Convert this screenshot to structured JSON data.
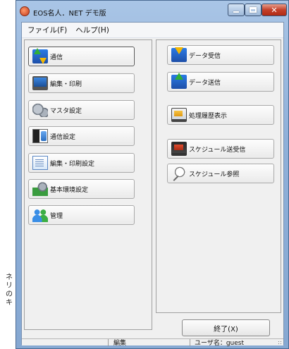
{
  "background_left_text": [
    "ネ",
    "リ",
    "の",
    "キ"
  ],
  "window": {
    "title": "EOS名人．NET デモ版",
    "accent_color": "#8fb0d9",
    "controls": {
      "minimize": "min",
      "maximize": "max",
      "close": "✕"
    }
  },
  "menubar": {
    "items": [
      {
        "label": "ファイル(F)"
      },
      {
        "label": "ヘルプ(H)"
      }
    ]
  },
  "left_pane": {
    "buttons": [
      {
        "label": "通信",
        "icon": "transfer-icon",
        "selected": true
      },
      {
        "label": "編集・印刷",
        "icon": "monitor-icon"
      },
      {
        "label": "マスタ設定",
        "icon": "gears-icon"
      },
      {
        "label": "通信設定",
        "icon": "server-icon"
      },
      {
        "label": "編集・印刷設定",
        "icon": "document-icon"
      },
      {
        "label": "基本環境設定",
        "icon": "environment-icon"
      },
      {
        "label": "管理",
        "icon": "users-icon"
      }
    ]
  },
  "right_pane": {
    "buttons": [
      {
        "label": "データ受信",
        "icon": "receive-icon"
      },
      {
        "label": "データ送信",
        "icon": "send-icon"
      },
      {
        "label": "処理履歴表示",
        "icon": "history-icon"
      },
      {
        "label": "スケジュール送受信",
        "icon": "schedule-icon"
      },
      {
        "label": "スケジュール参照",
        "icon": "magnifier-icon"
      }
    ]
  },
  "exit_button": {
    "label": "終了(X)"
  },
  "statusbar": {
    "mode": "編集",
    "user": "ユーザ名：guest"
  }
}
